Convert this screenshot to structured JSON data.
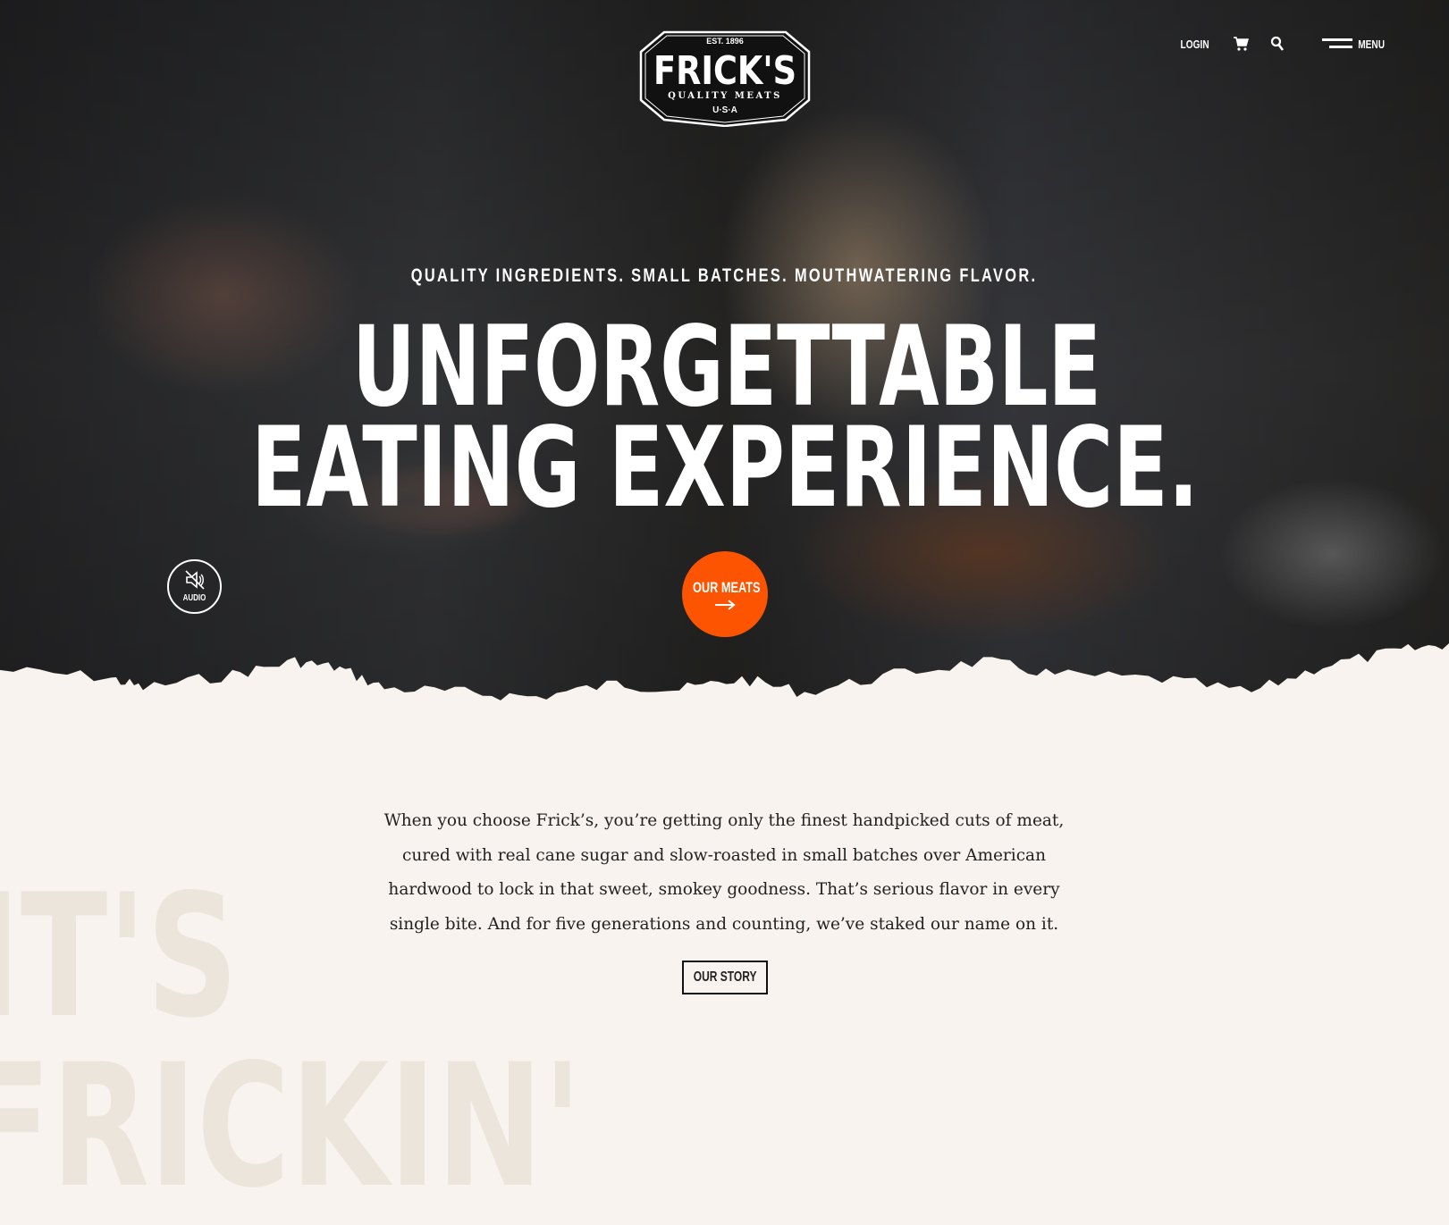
{
  "brand": {
    "name": "FRICK'S",
    "established": "EST. 1896",
    "subtitle": "QUALITY MEATS",
    "country": "U·S·A"
  },
  "nav": {
    "login": "LOGIN",
    "cart_icon": "cart-icon",
    "search_icon": "search-icon",
    "menu": "MENU"
  },
  "hero": {
    "tagline": "QUALITY INGREDIENTS. SMALL BATCHES. MOUTHWATERING FLAVOR.",
    "headline_line1": "UNFORGETTABLE",
    "headline_line2": "EATING EXPERIENCE.",
    "audio_label": "AUDIO",
    "audio_icon": "speaker-muted-icon",
    "cta_label": "OUR MEATS",
    "cta_icon": "arrow-right-icon"
  },
  "intro": {
    "watermark_line1": "IT'S",
    "watermark_line2": "FRICKIN'",
    "paragraph_lines": [
      "When you choose Frick’s, you’re getting only the finest handpicked cuts of meat,",
      "cured with real cane sugar and slow-roasted in small batches over American",
      "hardwood to lock in that sweet, smokey goodness. That’s serious flavor in every",
      "single bite. And for five generations and counting, we’ve staked our name on it."
    ],
    "story_button": "OUR STORY"
  },
  "colors": {
    "accent": "#fd5401",
    "background": "#f8f3ee",
    "text": "#222222"
  }
}
